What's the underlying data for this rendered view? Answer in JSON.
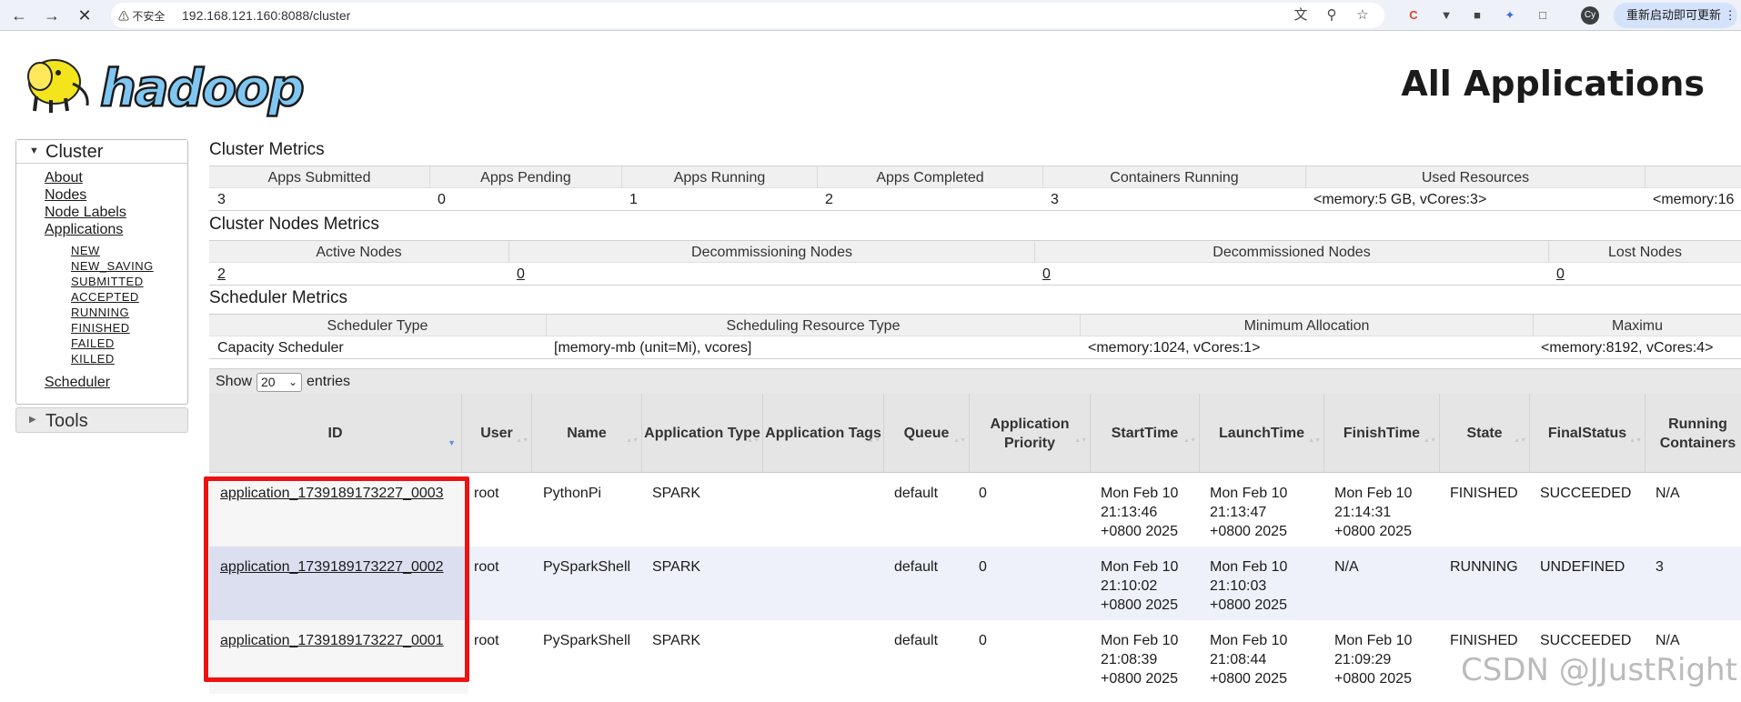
{
  "browser": {
    "security_label": "不安全",
    "url": "192.168.121.160:8088/cluster",
    "update_button": "重新启动即可更新",
    "profile_initials": "Cy"
  },
  "page": {
    "title": "All Applications",
    "logo_text": "hadoop"
  },
  "nav": {
    "cluster_label": "Cluster",
    "links": [
      "About",
      "Nodes",
      "Node Labels",
      "Applications"
    ],
    "app_states": [
      "NEW",
      "NEW_SAVING",
      "SUBMITTED",
      "ACCEPTED",
      "RUNNING",
      "FINISHED",
      "FAILED",
      "KILLED"
    ],
    "scheduler_link": "Scheduler",
    "tools_label": "Tools"
  },
  "cluster_metrics": {
    "title": "Cluster Metrics",
    "headers": [
      "Apps Submitted",
      "Apps Pending",
      "Apps Running",
      "Apps Completed",
      "Containers Running",
      "Used Resources",
      ""
    ],
    "values": [
      "3",
      "0",
      "1",
      "2",
      "3",
      "<memory:5 GB, vCores:3>",
      "<memory:16"
    ]
  },
  "nodes_metrics": {
    "title": "Cluster Nodes Metrics",
    "headers": [
      "Active Nodes",
      "Decommissioning Nodes",
      "Decommissioned Nodes",
      "Lost Nodes"
    ],
    "values": [
      "2",
      "0",
      "0",
      "0"
    ]
  },
  "scheduler_metrics": {
    "title": "Scheduler Metrics",
    "headers": [
      "Scheduler Type",
      "Scheduling Resource Type",
      "Minimum Allocation",
      "Maximu"
    ],
    "values": [
      "Capacity Scheduler",
      "[memory-mb (unit=Mi), vcores]",
      "<memory:1024, vCores:1>",
      "<memory:8192, vCores:4>"
    ]
  },
  "apps_table": {
    "show_label": "Show",
    "entries_value": "20",
    "entries_label": "entries",
    "columns": [
      "ID",
      "User",
      "Name",
      "Application Type",
      "Application Tags",
      "Queue",
      "Application Priority",
      "StartTime",
      "LaunchTime",
      "FinishTime",
      "State",
      "FinalStatus",
      "Running Containers"
    ],
    "rows": [
      {
        "id": "application_1739189173227_0003",
        "user": "root",
        "name": "PythonPi",
        "type": "SPARK",
        "tags": "",
        "queue": "default",
        "priority": "0",
        "start": [
          "Mon Feb 10",
          "21:13:46",
          "+0800 2025"
        ],
        "launch": [
          "Mon Feb 10",
          "21:13:47",
          "+0800 2025"
        ],
        "finish": [
          "Mon Feb 10",
          "21:14:31",
          "+0800 2025"
        ],
        "state": "FINISHED",
        "final_status": "SUCCEEDED",
        "running_containers": "N/A"
      },
      {
        "id": "application_1739189173227_0002",
        "user": "root",
        "name": "PySparkShell",
        "type": "SPARK",
        "tags": "",
        "queue": "default",
        "priority": "0",
        "start": [
          "Mon Feb 10",
          "21:10:02",
          "+0800 2025"
        ],
        "launch": [
          "Mon Feb 10",
          "21:10:03",
          "+0800 2025"
        ],
        "finish": [
          "N/A",
          "",
          ""
        ],
        "state": "RUNNING",
        "final_status": "UNDEFINED",
        "running_containers": "3"
      },
      {
        "id": "application_1739189173227_0001",
        "user": "root",
        "name": "PySparkShell",
        "type": "SPARK",
        "tags": "",
        "queue": "default",
        "priority": "0",
        "start": [
          "Mon Feb 10",
          "21:08:39",
          "+0800 2025"
        ],
        "launch": [
          "Mon Feb 10",
          "21:08:44",
          "+0800 2025"
        ],
        "finish": [
          "Mon Feb 10",
          "21:09:29",
          "+0800 2025"
        ],
        "state": "FINISHED",
        "final_status": "SUCCEEDED",
        "running_containers": "N/A"
      }
    ]
  },
  "watermark": "CSDN @JJustRight",
  "colors": {
    "highlight": "#ee1111",
    "row_even": "#eef0fa",
    "sort_active": "#6b8fd6"
  }
}
